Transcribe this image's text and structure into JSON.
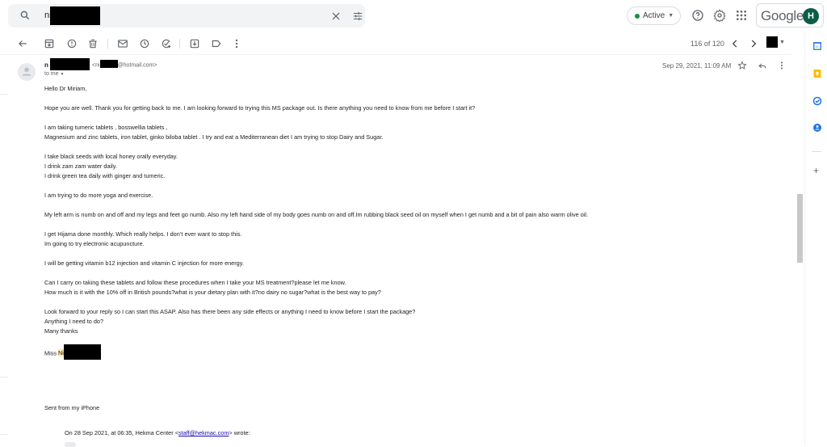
{
  "search": {
    "query": "ni",
    "clear_icon": "close-icon",
    "options_icon": "tune-icon"
  },
  "topbar": {
    "status_label": "Active",
    "status_color": "#1e8e3e",
    "help_icon": "help-icon",
    "settings_icon": "gear-icon",
    "apps_icon": "apps-grid-icon",
    "brand": "Google",
    "avatar_initial": "H",
    "avatar_color": "#0b5d46"
  },
  "toolbar": {
    "actions": [
      "back",
      "archive",
      "report-spam",
      "delete",
      "mark-unread",
      "snooze",
      "add-to-tasks",
      "move-to",
      "labels",
      "more"
    ],
    "counter": "116 of 120"
  },
  "message": {
    "sender_prefix": "n",
    "email_prefix": "<ni",
    "email_suffix": "@hotmail.com>",
    "to": "to me",
    "date": "Sep 29, 2021, 11:09 AM",
    "greeting": "Hello Dr Miriam,",
    "paragraphs": [
      [
        "Hope you are well. Thank you for getting back to me. I am looking forward to trying this MS package out. Is there anything you need to know from me before I start it?"
      ],
      [
        "I am taking tumeric tablets , bosswellia tablets ,",
        "Magnesium and zinc tablets, iron tablet, ginko biloba tablet . I try and eat a Mediterranean diet I am trying to stop Dairy and Sugar."
      ],
      [
        "I take black seeds with local honey orally everyday.",
        "I drink zam zam water daily.",
        "I drink green tea daily with ginger and tumeric."
      ],
      [
        "I am trying to do more yoga and exercise."
      ],
      [
        "My left arm is numb on and off and my legs and feet go numb. Also my left hand side of my body goes numb on and off.Im rubbing black seed oil on myself when I get numb and a bit of pain also warm olive oil."
      ],
      [
        "I get Hijama done monthly. Which really helps. I don’t ever want to stop this.",
        "Im going to try electronic acupuncture."
      ],
      [
        "I will be getting vitamin b12 injection and vitamin C injection for more energy."
      ],
      [
        "Can I carry on taking these tablets and follow these procedures when I take your MS treatment?please let me know.",
        "How much is it with the 10% off in British pounds?what is your dietary plan with it?no dairy no sugar?what is the best way to pay?"
      ],
      [
        "Look forward to your reply so I can start this ASAP. Also has there been any side effects or anything I need to know before I start the package?",
        "Anything I need to do?",
        "Many thanks"
      ]
    ],
    "signature_prefix": "Miss ",
    "signature_highlight": "Ni",
    "sent_from": "Sent from my iPhone",
    "quote_intro": "On 28 Sep 2021, at 06:35, Hekma Center <",
    "quote_email": "staff@hekmac.com",
    "quote_outro": "> wrote:"
  },
  "side_panel": {
    "apps": [
      "calendar-icon",
      "keep-icon",
      "tasks-icon",
      "contacts-icon"
    ],
    "add_label": "+"
  }
}
